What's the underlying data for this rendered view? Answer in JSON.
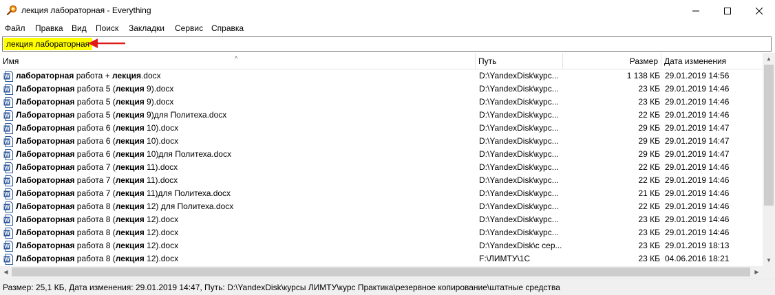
{
  "window": {
    "title": "лекция лабораторная - Everything",
    "controls": {
      "minimize": "—",
      "maximize": "☐",
      "close": "✕"
    }
  },
  "menu": [
    "Файл",
    "Правка",
    "Вид",
    "Поиск",
    "Закладки",
    "Сервис",
    "Справка"
  ],
  "search": {
    "value": "лекция  лабораторная",
    "highlight_color": "#ffff00",
    "arrow_color": "#e11a1a"
  },
  "columns": {
    "name": "Имя",
    "path": "Путь",
    "size": "Размер",
    "date": "Дата изменения"
  },
  "rows": [
    {
      "icon": "word-doc-icon",
      "segments": [
        {
          "t": "лабораторная",
          "b": true
        },
        {
          "t": " работа + ",
          "b": false
        },
        {
          "t": "лекция",
          "b": true
        },
        {
          "t": ".docx",
          "b": false
        }
      ],
      "path": "D:\\YandexDisk\\курс...",
      "size": "1 138 КБ",
      "date": "29.01.2019 14:56"
    },
    {
      "icon": "word-doc-icon",
      "segments": [
        {
          "t": "Лабораторная",
          "b": true
        },
        {
          "t": " работа 5 (",
          "b": false
        },
        {
          "t": "лекция",
          "b": true
        },
        {
          "t": " 9).docx",
          "b": false
        }
      ],
      "path": "D:\\YandexDisk\\курс...",
      "size": "23 КБ",
      "date": "29.01.2019 14:46"
    },
    {
      "icon": "word-doc-icon",
      "segments": [
        {
          "t": "Лабораторная",
          "b": true
        },
        {
          "t": " работа 5 (",
          "b": false
        },
        {
          "t": "лекция",
          "b": true
        },
        {
          "t": " 9).docx",
          "b": false
        }
      ],
      "path": "D:\\YandexDisk\\курс...",
      "size": "23 КБ",
      "date": "29.01.2019 14:46"
    },
    {
      "icon": "word-doc-icon",
      "segments": [
        {
          "t": "Лабораторная",
          "b": true
        },
        {
          "t": " работа 5 (",
          "b": false
        },
        {
          "t": "лекция",
          "b": true
        },
        {
          "t": " 9)для Политеха.docx",
          "b": false
        }
      ],
      "path": "D:\\YandexDisk\\курс...",
      "size": "22 КБ",
      "date": "29.01.2019 14:46"
    },
    {
      "icon": "word-doc-icon",
      "segments": [
        {
          "t": "Лабораторная",
          "b": true
        },
        {
          "t": " работа 6 (",
          "b": false
        },
        {
          "t": "лекция",
          "b": true
        },
        {
          "t": " 10).docx",
          "b": false
        }
      ],
      "path": "D:\\YandexDisk\\курс...",
      "size": "29 КБ",
      "date": "29.01.2019 14:47"
    },
    {
      "icon": "word-doc-icon",
      "segments": [
        {
          "t": "Лабораторная",
          "b": true
        },
        {
          "t": " работа 6 (",
          "b": false
        },
        {
          "t": "лекция",
          "b": true
        },
        {
          "t": " 10).docx",
          "b": false
        }
      ],
      "path": "D:\\YandexDisk\\курс...",
      "size": "29 КБ",
      "date": "29.01.2019 14:47"
    },
    {
      "icon": "word-doc-icon",
      "segments": [
        {
          "t": "Лабораторная",
          "b": true
        },
        {
          "t": " работа 6 (",
          "b": false
        },
        {
          "t": "лекция",
          "b": true
        },
        {
          "t": " 10)для Политеха.docx",
          "b": false
        }
      ],
      "path": "D:\\YandexDisk\\курс...",
      "size": "29 КБ",
      "date": "29.01.2019 14:47"
    },
    {
      "icon": "word-doc-icon",
      "segments": [
        {
          "t": "Лабораторная",
          "b": true
        },
        {
          "t": " работа 7 (",
          "b": false
        },
        {
          "t": "лекция",
          "b": true
        },
        {
          "t": " 11).docx",
          "b": false
        }
      ],
      "path": "D:\\YandexDisk\\курс...",
      "size": "22 КБ",
      "date": "29.01.2019 14:46"
    },
    {
      "icon": "word-doc-icon",
      "segments": [
        {
          "t": "Лабораторная",
          "b": true
        },
        {
          "t": " работа 7 (",
          "b": false
        },
        {
          "t": "лекция",
          "b": true
        },
        {
          "t": " 11).docx",
          "b": false
        }
      ],
      "path": "D:\\YandexDisk\\курс...",
      "size": "22 КБ",
      "date": "29.01.2019 14:46"
    },
    {
      "icon": "word-doc-icon",
      "segments": [
        {
          "t": "Лабораторная",
          "b": true
        },
        {
          "t": " работа 7 (",
          "b": false
        },
        {
          "t": "лекция",
          "b": true
        },
        {
          "t": " 11)для Политеха.docx",
          "b": false
        }
      ],
      "path": "D:\\YandexDisk\\курс...",
      "size": "21 КБ",
      "date": "29.01.2019 14:46"
    },
    {
      "icon": "word-doc-icon",
      "segments": [
        {
          "t": "Лабораторная",
          "b": true
        },
        {
          "t": " работа 8 (",
          "b": false
        },
        {
          "t": "лекция",
          "b": true
        },
        {
          "t": " 12) для Политеха.docx",
          "b": false
        }
      ],
      "path": "D:\\YandexDisk\\курс...",
      "size": "22 КБ",
      "date": "29.01.2019 14:46"
    },
    {
      "icon": "word-doc-icon",
      "segments": [
        {
          "t": "Лабораторная",
          "b": true
        },
        {
          "t": " работа 8 (",
          "b": false
        },
        {
          "t": "лекция",
          "b": true
        },
        {
          "t": " 12).docx",
          "b": false
        }
      ],
      "path": "D:\\YandexDisk\\курс...",
      "size": "23 КБ",
      "date": "29.01.2019 14:46"
    },
    {
      "icon": "word-doc-icon",
      "segments": [
        {
          "t": "Лабораторная",
          "b": true
        },
        {
          "t": " работа 8 (",
          "b": false
        },
        {
          "t": "лекция",
          "b": true
        },
        {
          "t": " 12).docx",
          "b": false
        }
      ],
      "path": "D:\\YandexDisk\\курс...",
      "size": "23 КБ",
      "date": "29.01.2019 14:46"
    },
    {
      "icon": "word-doc-icon",
      "segments": [
        {
          "t": "Лабораторная",
          "b": true
        },
        {
          "t": " работа 8 (",
          "b": false
        },
        {
          "t": "лекция",
          "b": true
        },
        {
          "t": " 12).docx",
          "b": false
        }
      ],
      "path": "D:\\YandexDisk\\с сер...",
      "size": "23 КБ",
      "date": "29.01.2019 18:13"
    },
    {
      "icon": "word-doc-icon",
      "segments": [
        {
          "t": "Лабораторная",
          "b": true
        },
        {
          "t": " работа 8 (",
          "b": false
        },
        {
          "t": "лекция",
          "b": true
        },
        {
          "t": " 12).docx",
          "b": false
        }
      ],
      "path": "F:\\ЛИМТУ\\1С",
      "size": "23 КБ",
      "date": "04.06.2016 18:21"
    }
  ],
  "status": "Размер: 25,1 КБ, Дата изменения: 29.01.2019 14:47, Путь: D:\\YandexDisk\\курсы ЛИМТУ\\курс Практика\\резервное копирование\\штатные средства"
}
